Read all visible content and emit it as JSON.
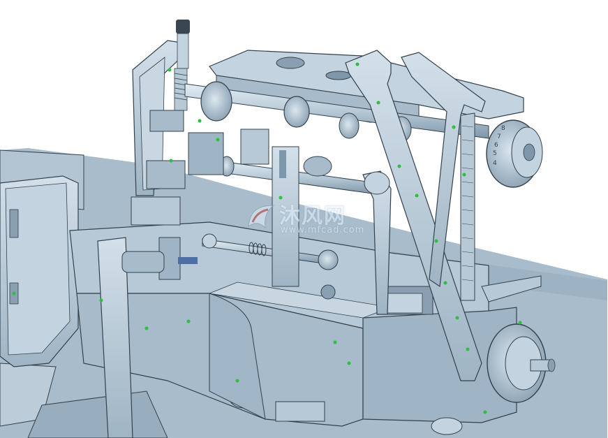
{
  "scene": {
    "description_type": "cad-render",
    "colors": {
      "background": "#ffffff",
      "table": "#a9bccb",
      "table_shadow": "#8aa0b2",
      "metal": "#b7c9d6",
      "metal_light": "#d3e0ea",
      "metal_dark": "#7f97aa",
      "outline": "#33414c",
      "green_dot": "#2fbf3f"
    }
  },
  "watermark": {
    "text_cn": "沐风网",
    "url": "www.mfcad.com",
    "logo_icon": "mfcad-logo-icon"
  },
  "handwheel_scale": {
    "labels": [
      "8",
      "7",
      "6",
      "5",
      "4"
    ]
  }
}
